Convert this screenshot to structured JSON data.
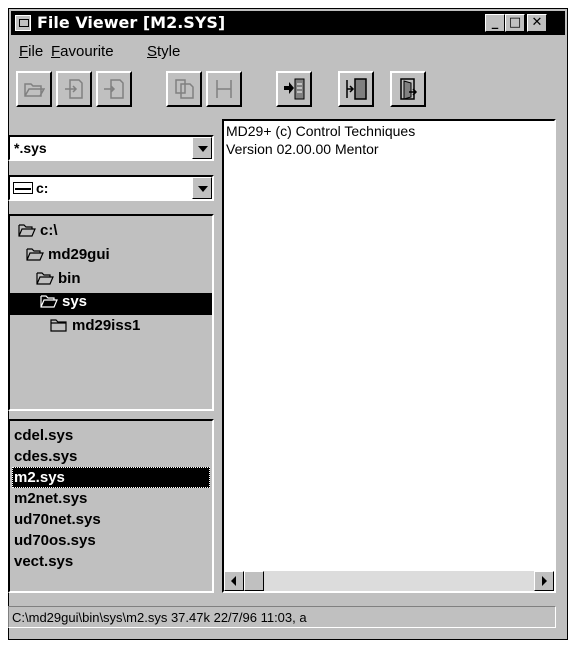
{
  "window": {
    "title": "File Viewer [M2.SYS]",
    "minimize_label": "_",
    "maximize_label": "□",
    "close_label": "✕"
  },
  "menu": {
    "items": [
      {
        "underline": "F",
        "rest": "ile"
      },
      {
        "underline": "F",
        "rest": "avourite"
      },
      {
        "underline": "S",
        "rest": "tyle"
      }
    ]
  },
  "toolbar": {
    "buttons": [
      {
        "icon": "open-folder-icon",
        "enabled": false
      },
      {
        "icon": "export-file-icon",
        "enabled": false
      },
      {
        "icon": "import-file-icon",
        "enabled": false
      },
      {
        "icon": "copy-icon",
        "enabled": false
      },
      {
        "icon": "save-icon",
        "enabled": false
      },
      {
        "icon": "send-to-panel-icon",
        "enabled": true
      },
      {
        "icon": "receive-panel-icon",
        "enabled": true
      },
      {
        "icon": "exit-door-icon",
        "enabled": true
      }
    ]
  },
  "filter": {
    "value": "*.sys"
  },
  "drive": {
    "value": "c:"
  },
  "directories": [
    {
      "name": "c:\\",
      "level": 0,
      "selected": false
    },
    {
      "name": "md29gui",
      "level": 1,
      "selected": false
    },
    {
      "name": "bin",
      "level": 2,
      "selected": false
    },
    {
      "name": "sys",
      "level": 3,
      "selected": true
    },
    {
      "name": "md29iss1",
      "level": 4,
      "selected": false
    }
  ],
  "files": [
    "cdel.sys",
    "cdes.sys",
    "m2.sys",
    "m2net.sys",
    "ud70net.sys",
    "ud70os.sys",
    "vect.sys"
  ],
  "selected_file": "m2.sys",
  "viewer": {
    "lines": [
      "MD29+ (c) Control Techniques",
      "Version 02.00.00 Mentor"
    ]
  },
  "status": {
    "text": "C:\\md29gui\\bin\\sys\\m2.sys  37.47k  22/7/96 11:03, a"
  },
  "colors": {
    "selection": "#000000",
    "face": "#c0c0c0",
    "disabled": "#808080"
  }
}
